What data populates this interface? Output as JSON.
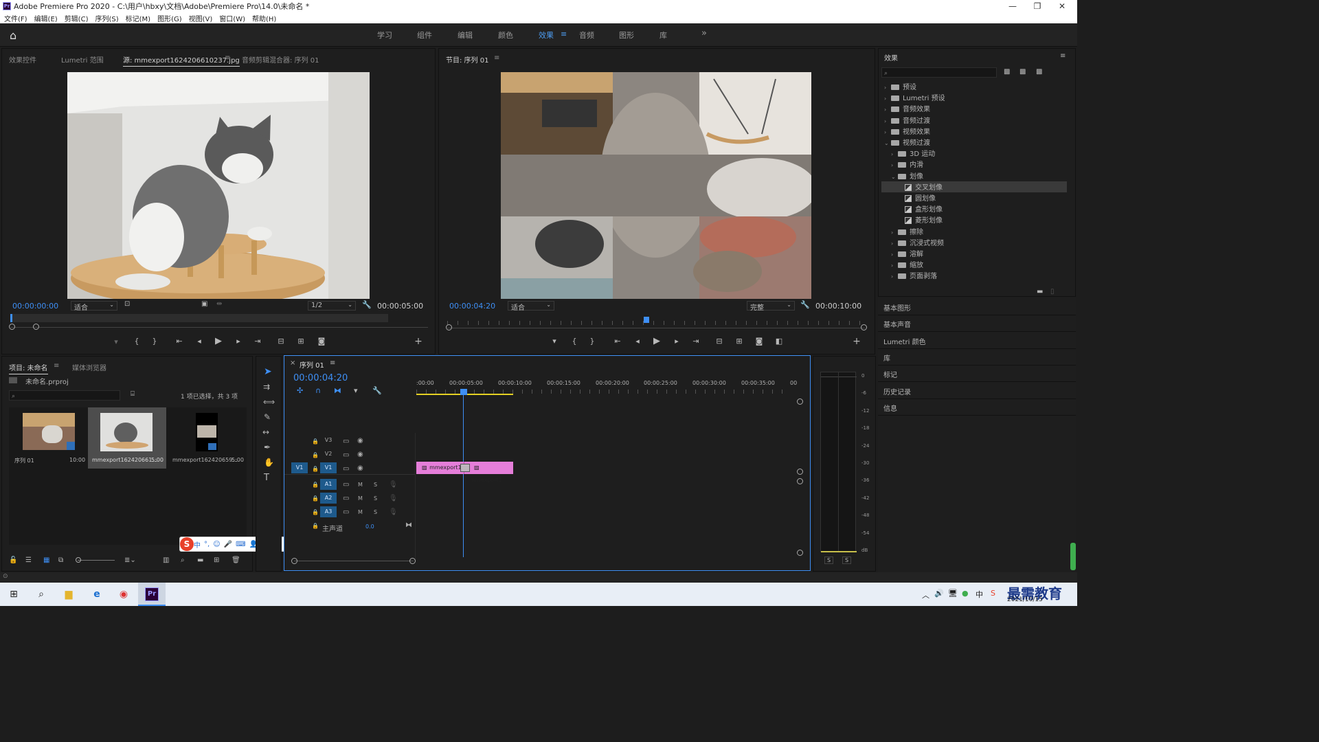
{
  "window": {
    "title": "Adobe Premiere Pro 2020 - C:\\用户\\hbxy\\文档\\Adobe\\Premiere Pro\\14.0\\未命名 *",
    "logo": "Pr",
    "minimize": "—",
    "restore": "❐",
    "close": "✕"
  },
  "menu": [
    "文件(F)",
    "编辑(E)",
    "剪辑(C)",
    "序列(S)",
    "标记(M)",
    "图形(G)",
    "视图(V)",
    "窗口(W)",
    "帮助(H)"
  ],
  "workspaces": {
    "items": [
      "学习",
      "组件",
      "编辑",
      "颜色",
      "效果",
      "音频",
      "图形",
      "库"
    ],
    "active": "效果",
    "more": "»"
  },
  "source_panel": {
    "tabs": [
      "效果控件",
      "Lumetri 范围",
      "源: mmexport1624206610237.jpg",
      "音频剪辑混合器: 序列 01"
    ],
    "timecode_in": "00:00:00:00",
    "fit": "适合",
    "resolution": "1/2",
    "duration": "00:00:05:00"
  },
  "program_panel": {
    "title": "节目: 序列 01",
    "timecode": "00:00:04:20",
    "fit": "适合",
    "quality": "完整",
    "duration": "00:00:10:00"
  },
  "effects_panel": {
    "title": "效果",
    "tree": [
      {
        "label": "预设",
        "level": 0,
        "open": false
      },
      {
        "label": "Lumetri 预设",
        "level": 0,
        "open": false
      },
      {
        "label": "音频效果",
        "level": 0,
        "open": false
      },
      {
        "label": "音频过渡",
        "level": 0,
        "open": false
      },
      {
        "label": "视频效果",
        "level": 0,
        "open": false
      },
      {
        "label": "视频过渡",
        "level": 0,
        "open": true
      },
      {
        "label": "3D 运动",
        "level": 1,
        "open": false
      },
      {
        "label": "内滑",
        "level": 1,
        "open": false
      },
      {
        "label": "划像",
        "level": 1,
        "open": true
      },
      {
        "label": "交叉划像",
        "level": 2,
        "selected": true
      },
      {
        "label": "圆划像",
        "level": 2
      },
      {
        "label": "盒形划像",
        "level": 2
      },
      {
        "label": "菱形划像",
        "level": 2
      },
      {
        "label": "擦除",
        "level": 1,
        "open": false
      },
      {
        "label": "沉浸式视频",
        "level": 1,
        "open": false
      },
      {
        "label": "溶解",
        "level": 1,
        "open": false
      },
      {
        "label": "缩放",
        "level": 1,
        "open": false
      },
      {
        "label": "页面剥落",
        "level": 1,
        "open": false
      }
    ],
    "side_panels": [
      "基本图形",
      "基本声音",
      "Lumetri 颜色",
      "库",
      "标记",
      "历史记录",
      "信息"
    ]
  },
  "project_panel": {
    "tabs": [
      "项目: 未命名",
      "媒体浏览器"
    ],
    "file": "未命名.prproj",
    "selection": "1 项已选择，共 3 项",
    "items": [
      {
        "name": "序列 01",
        "duration": "10:00"
      },
      {
        "name": "mmexport162420661...",
        "duration": "5:00"
      },
      {
        "name": "mmexport162420659...",
        "duration": "5:00"
      }
    ]
  },
  "timeline": {
    "title": "序列 01",
    "timecode": "00:00:04:20",
    "ruler": [
      ":00:00",
      "00:00:05:00",
      "00:00:10:00",
      "00:00:15:00",
      "00:00:20:00",
      "00:00:25:00",
      "00:00:30:00",
      "00:00:35:00",
      "00"
    ],
    "video_tracks": [
      "V3",
      "V2",
      "V1"
    ],
    "audio_tracks": [
      "A1",
      "A2",
      "A3"
    ],
    "source_patch": "V1",
    "master_label": "主声道",
    "master_value": "0.0",
    "clips": [
      "mmexport1",
      "mmexport1"
    ],
    "mute": "M",
    "solo": "S"
  },
  "audio_meter": {
    "ticks": [
      "0",
      "-6",
      "-12",
      "-18",
      "-24",
      "-30",
      "-36",
      "-42",
      "-48",
      "-54",
      "dB"
    ],
    "buttons": [
      "S",
      "S"
    ]
  },
  "ime_toolbar": [
    "中",
    "°,",
    "☺",
    "🎤",
    "⌨",
    "👤",
    "👕",
    "▦"
  ],
  "taskbar": {
    "date": "2021/10/15",
    "watermark": "最需教育"
  },
  "colors": {
    "accent_blue": "#3e8ff5",
    "clip_pink": "#e57ed9",
    "panel_bg": "#1e1e1e"
  }
}
